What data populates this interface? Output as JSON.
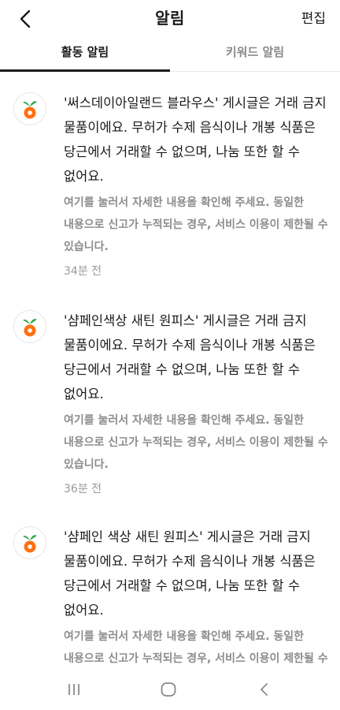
{
  "header": {
    "title": "알림",
    "edit_label": "편집"
  },
  "tabs": [
    {
      "label": "활동 알림",
      "active": true
    },
    {
      "label": "키워드 알림",
      "active": false
    }
  ],
  "notifications": [
    {
      "message": "'써스데이아일랜드 블라우스' 게시글은 거래 금지 물품이에요. 무허가 수제 음식이나 개봉 식품은 당근에서 거래할 수 없으며, 나눔 또한 할 수 없어요.",
      "detail": "여기를 눌러서 자세한 내용을 확인해 주세요. 동일한 내용으로 신고가 누적되는 경우, 서비스 이용이 제한될 수 있습니다.",
      "time": "34분 전"
    },
    {
      "message": "'샴페인색상 새틴 원피스' 게시글은 거래 금지 물품이에요. 무허가 수제 음식이나 개봉 식품은 당근에서 거래할 수 없으며, 나눔 또한 할 수 없어요.",
      "detail": "여기를 눌러서 자세한 내용을 확인해 주세요. 동일한 내용으로 신고가 누적되는 경우, 서비스 이용이 제한될 수 있습니다.",
      "time": "36분 전"
    },
    {
      "message": "'샴페인 색상 새틴 원피스' 게시글은 거래 금지 물품이에요. 무허가 수제 음식이나 개봉 식품은 당근에서 거래할 수 없으며, 나눔 또한 할 수 없어요.",
      "detail": "여기를 눌러서 자세한 내용을 확인해 주세요. 동일한 내용으로 신고가 누적되는 경우, 서비스 이용이 제한될 수 있습니다.",
      "time": ""
    }
  ],
  "icons": {
    "back": "chevron-left-icon",
    "avatar": "carrot-logo-icon",
    "nav_recent": "recent-apps-icon",
    "nav_home": "home-icon",
    "nav_back": "back-icon"
  },
  "colors": {
    "carrot_orange": "#ff6f0f",
    "leaf_green": "#2fa54a",
    "secondary_text": "#8c8c8c"
  }
}
